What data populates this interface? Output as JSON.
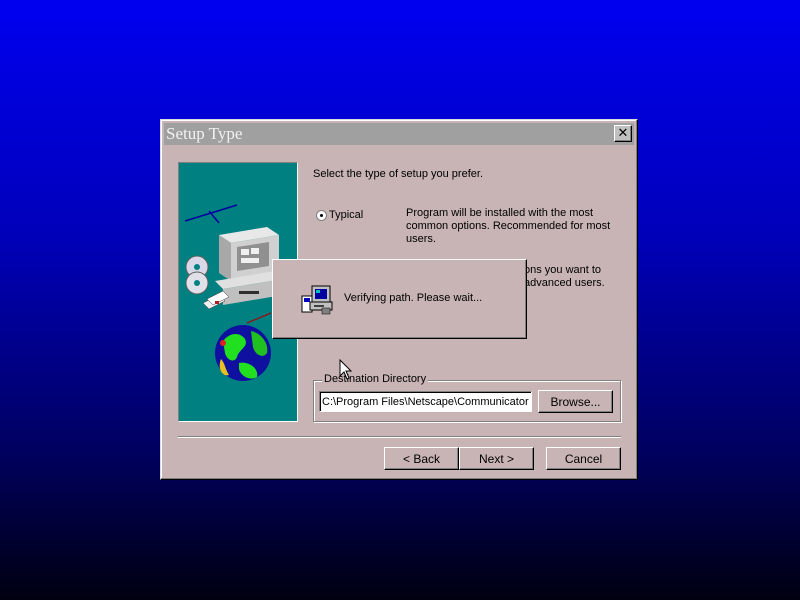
{
  "window": {
    "title": "Setup Type",
    "close_glyph": "✕"
  },
  "content": {
    "prompt": "Select the type of setup you prefer.",
    "options": [
      {
        "label": "Typical",
        "selected": true,
        "description": [
          "Program will be installed with the most",
          "common options. Recommended for most",
          "users."
        ]
      },
      {
        "label": "",
        "selected": false,
        "description": [
          "ons you want to",
          "advanced users."
        ]
      }
    ]
  },
  "destination": {
    "legend": "Destination Directory",
    "path": "C:\\Program Files\\Netscape\\Communicator",
    "browse_label": "Browse..."
  },
  "buttons": {
    "back": "< Back",
    "next": "Next >",
    "cancel": "Cancel"
  },
  "progress_dialog": {
    "message": "Verifying path.  Please wait...",
    "icon": "setup-computer-icon"
  },
  "colors": {
    "desktop_top": "#0000f0",
    "desktop_bottom": "#000010",
    "dialog_face": "#c8b4b4",
    "titlebar": "#a0a0a0",
    "illustration_bg": "#008080"
  }
}
